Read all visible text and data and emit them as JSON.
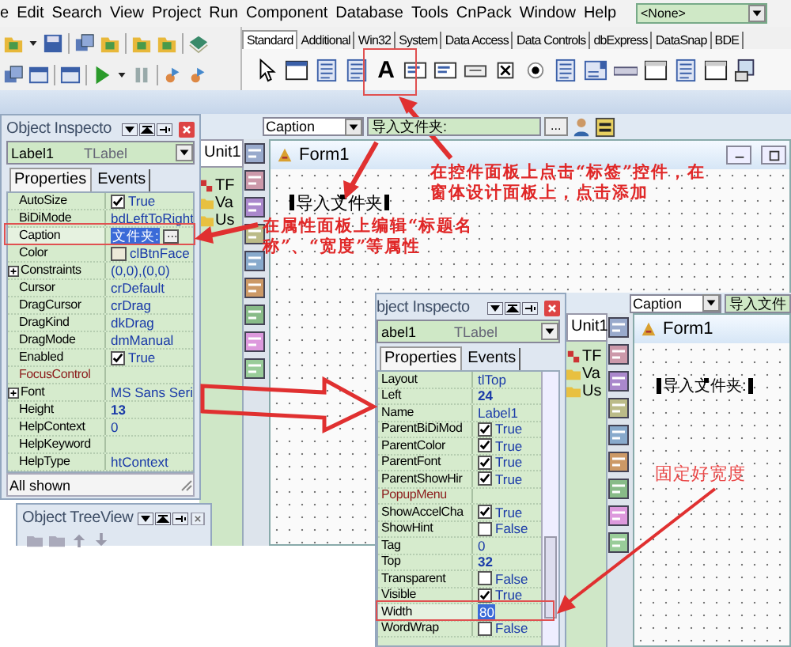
{
  "menu_bar": {
    "items": [
      "e",
      "Edit",
      "Search",
      "View",
      "Project",
      "Run",
      "Component",
      "Database",
      "Tools",
      "CnPack",
      "Window",
      "Help"
    ],
    "layout_combo": "<None>"
  },
  "palette": {
    "tabs": [
      {
        "label": "Standard",
        "selected": true
      },
      {
        "label": "Additional",
        "selected": false
      },
      {
        "label": "Win32",
        "selected": false
      },
      {
        "label": "System",
        "selected": false
      },
      {
        "label": "Data Access",
        "selected": false
      },
      {
        "label": "Data Controls",
        "selected": false
      },
      {
        "label": "dbExpress",
        "selected": false
      },
      {
        "label": "DataSnap",
        "selected": false
      },
      {
        "label": "BDE",
        "selected": false
      }
    ],
    "label_glyph": "A"
  },
  "inspectors": [
    {
      "title": "Object Inspecto",
      "object": "Label1",
      "type": "TLabel",
      "tabs": [
        {
          "label": "Properties",
          "selected": true
        },
        {
          "label": "Events",
          "selected": false
        }
      ],
      "footer": "All shown",
      "rows": [
        {
          "name": "AutoSize",
          "kind": "check",
          "value": "True",
          "checked": true,
          "bold": false,
          "selected": false
        },
        {
          "name": "BiDiMode",
          "kind": "text",
          "value": "bdLeftToRight",
          "bold": false,
          "selected": false
        },
        {
          "name": "Caption",
          "kind": "text",
          "value": "文件夹:",
          "bold": false,
          "selected": true
        },
        {
          "name": "Color",
          "kind": "color",
          "value": "clBtnFace",
          "bold": false,
          "selected": false
        },
        {
          "name": "Constraints",
          "kind": "set",
          "value": "(0,0),(0,0)",
          "bold": false,
          "selected": false
        },
        {
          "name": "Cursor",
          "kind": "text",
          "value": "crDefault",
          "bold": false,
          "selected": false
        },
        {
          "name": "DragCursor",
          "kind": "text",
          "value": "crDrag",
          "bold": false,
          "selected": false
        },
        {
          "name": "DragKind",
          "kind": "text",
          "value": "dkDrag",
          "bold": false,
          "selected": false
        },
        {
          "name": "DragMode",
          "kind": "text",
          "value": "dmManual",
          "bold": false,
          "selected": false
        },
        {
          "name": "Enabled",
          "kind": "check",
          "value": "True",
          "checked": true,
          "bold": false,
          "selected": false
        },
        {
          "name": "FocusControl",
          "kind": "ref",
          "selected": false
        },
        {
          "name": "Font",
          "kind": "set",
          "value": "MS Sans Seri",
          "bold": false,
          "selected": false
        },
        {
          "name": "Height",
          "kind": "text",
          "value": "13",
          "bold": true,
          "selected": false
        },
        {
          "name": "HelpContext",
          "kind": "text",
          "value": "0",
          "bold": false,
          "selected": false
        },
        {
          "name": "HelpKeyword",
          "kind": "text",
          "selected": false
        },
        {
          "name": "HelpType",
          "kind": "text",
          "value": "htContext",
          "bold": false,
          "selected": false
        }
      ]
    },
    {
      "title": "bject Inspecto",
      "object": "abel1",
      "type": "TLabel",
      "tabs": [
        {
          "label": "Properties",
          "selected": true
        },
        {
          "label": "Events",
          "selected": false
        }
      ],
      "rows": [
        {
          "name": "Layout",
          "kind": "text",
          "value": "tlTop",
          "bold": false,
          "selected": false
        },
        {
          "name": "Left",
          "kind": "text",
          "value": "24",
          "bold": true,
          "selected": false
        },
        {
          "name": "Name",
          "kind": "text",
          "value": "Label1",
          "bold": false,
          "selected": false
        },
        {
          "name": "ParentBiDiMod",
          "kind": "check",
          "value": "True",
          "checked": true,
          "bold": false,
          "selected": false
        },
        {
          "name": "ParentColor",
          "kind": "check",
          "value": "True",
          "checked": true,
          "bold": false,
          "selected": false
        },
        {
          "name": "ParentFont",
          "kind": "check",
          "value": "True",
          "checked": true,
          "bold": false,
          "selected": false
        },
        {
          "name": "ParentShowHir",
          "kind": "check",
          "value": "True",
          "checked": true,
          "bold": false,
          "selected": false
        },
        {
          "name": "PopupMenu",
          "kind": "ref",
          "selected": false
        },
        {
          "name": "ShowAccelCha",
          "kind": "check",
          "value": "True",
          "checked": true,
          "bold": false,
          "selected": false
        },
        {
          "name": "ShowHint",
          "kind": "check",
          "value": "False",
          "checked": false,
          "bold": false,
          "selected": false
        },
        {
          "name": "Tag",
          "kind": "text",
          "value": "0",
          "bold": false,
          "selected": false
        },
        {
          "name": "Top",
          "kind": "text",
          "value": "32",
          "bold": true,
          "selected": false
        },
        {
          "name": "Transparent",
          "kind": "check",
          "value": "False",
          "checked": false,
          "bold": false,
          "selected": false
        },
        {
          "name": "Visible",
          "kind": "check",
          "value": "True",
          "checked": true,
          "bold": false,
          "selected": false
        },
        {
          "name": "Width",
          "kind": "text",
          "value": "80",
          "bold": false,
          "selected": true
        },
        {
          "name": "WordWrap",
          "kind": "check",
          "value": "False",
          "checked": false,
          "bold": false,
          "selected": false
        }
      ]
    }
  ],
  "tree_view": {
    "title": "Object TreeView"
  },
  "designers": [
    {
      "property_combo": "Caption",
      "value_field": "导入文件夹:",
      "ellipsis": "...",
      "unit_tab": "Unit1",
      "tree": [
        "TF",
        "Va",
        "Us"
      ],
      "form_title": "Form1",
      "label": "导入文件夹"
    },
    {
      "property_combo": "Caption",
      "value_field": "导入文件",
      "unit_tab": "Unit1",
      "tree": [
        "TF",
        "Va",
        "Us"
      ],
      "form_title": "Form1",
      "label": "导入文件夹:"
    }
  ],
  "annotations": [
    {
      "lines": [
        "在控件面板上点击“标签”控件，在",
        "窗体设计面板上，点击添加"
      ]
    },
    {
      "lines": [
        "在属性面板上编辑“标题名",
        "称”、“宽度”等属性"
      ]
    },
    {
      "lines": [
        "固定好宽度"
      ]
    }
  ]
}
